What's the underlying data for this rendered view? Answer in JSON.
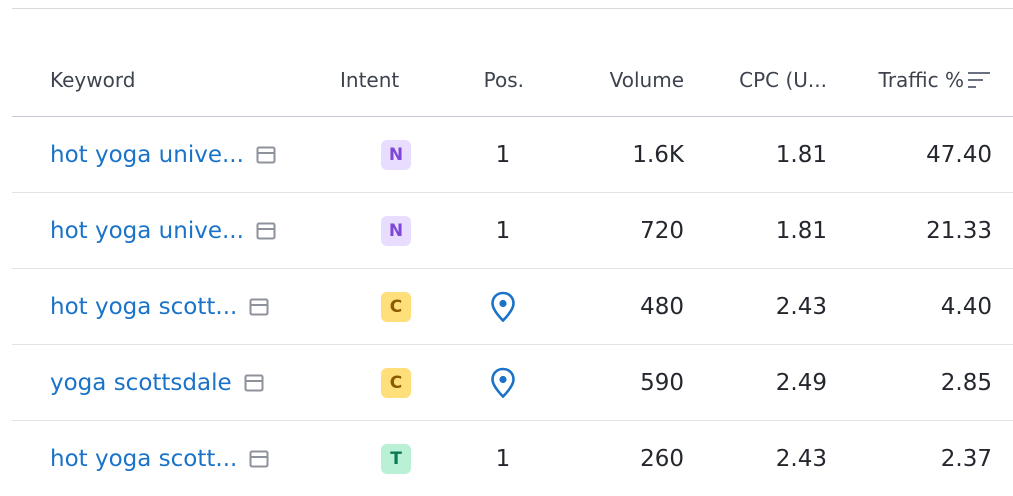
{
  "table": {
    "headers": {
      "keyword": "Keyword",
      "intent": "Intent",
      "pos": "Pos.",
      "volume": "Volume",
      "cpc": "CPC (U...",
      "traffic": "Traffic %"
    },
    "rows": [
      {
        "keyword": "hot yoga unive...",
        "intent": "N",
        "pos": "1",
        "pos_icon": "",
        "volume": "1.6K",
        "cpc": "1.81",
        "traffic": "47.40"
      },
      {
        "keyword": "hot yoga unive...",
        "intent": "N",
        "pos": "1",
        "pos_icon": "",
        "volume": "720",
        "cpc": "1.81",
        "traffic": "21.33"
      },
      {
        "keyword": "hot yoga scott...",
        "intent": "C",
        "pos": "",
        "pos_icon": "location-pin-icon",
        "volume": "480",
        "cpc": "2.43",
        "traffic": "4.40"
      },
      {
        "keyword": "yoga scottsdale",
        "intent": "C",
        "pos": "",
        "pos_icon": "location-pin-icon",
        "volume": "590",
        "cpc": "2.49",
        "traffic": "2.85"
      },
      {
        "keyword": "hot yoga scott...",
        "intent": "T",
        "pos": "1",
        "pos_icon": "",
        "volume": "260",
        "cpc": "2.43",
        "traffic": "2.37"
      }
    ]
  },
  "intent_colors": {
    "N": {
      "bg": "#e9ddff",
      "fg": "#7e47d6"
    },
    "C": {
      "bg": "#ffdf7a",
      "fg": "#8a5a00"
    },
    "T": {
      "bg": "#b9f0d6",
      "fg": "#0b7a52"
    }
  },
  "colors": {
    "link": "#1a73c9",
    "pin": "#1a73c9"
  }
}
